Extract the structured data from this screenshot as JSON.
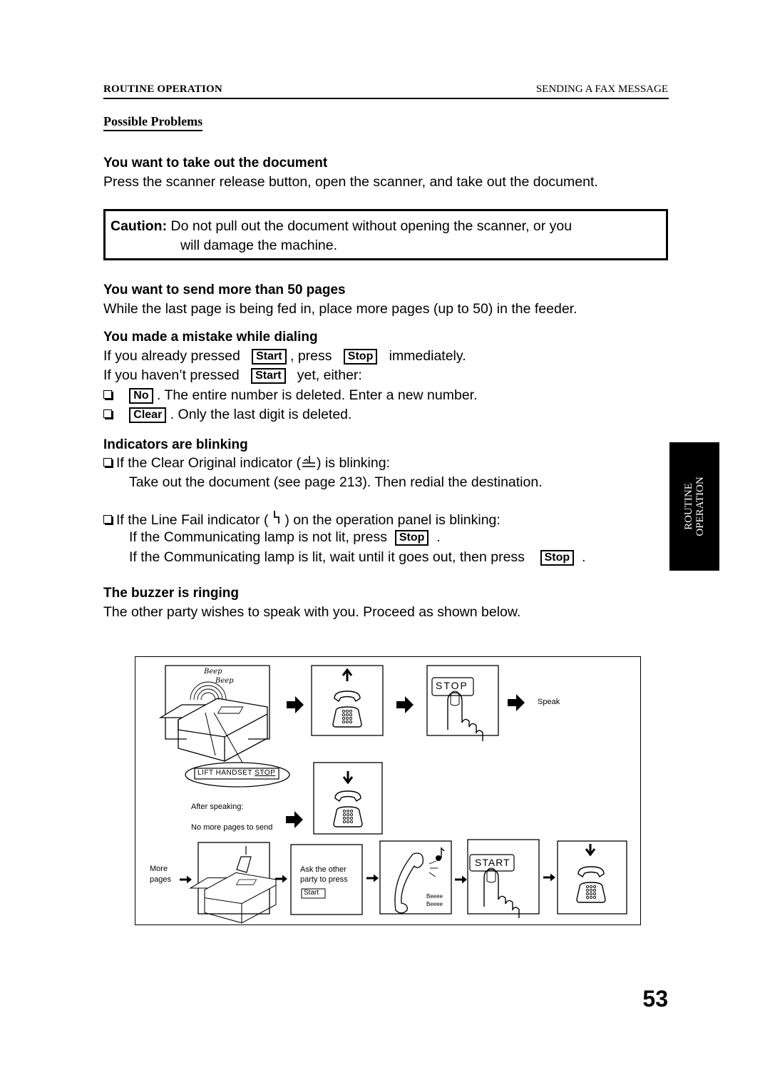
{
  "header": {
    "section": "ROUTINE OPERATION",
    "chapter": "SENDING A FAX MESSAGE"
  },
  "section_title": "Possible Problems",
  "problems": {
    "take_out": {
      "heading": "You want to take out the document",
      "text": "Press the scanner release button, open the scanner, and take out the document."
    },
    "caution": {
      "label": "Caution:",
      "line1": "Do not pull out the document without opening the scanner, or you",
      "line2": "will damage the machine."
    },
    "more_pages": {
      "heading": "You want to send more than 50 pages",
      "text": "While the last page is being fed in, place more pages (up to 50) in the feeder."
    },
    "mistake": {
      "heading": "You made a mistake while dialing",
      "line1_a": "If you already pressed",
      "line1_key1": "Start",
      "line1_b": ", press",
      "line1_key2": "Stop",
      "line1_c": "immediately.",
      "line2_a": "If you haven’t pressed",
      "line2_key": "Start",
      "line2_b": "yet, either:",
      "opt1_key": "No",
      "opt1_text": ". The entire number is deleted. Enter a new number.",
      "opt2_key": "Clear",
      "opt2_text": ". Only the last digit is deleted."
    },
    "indicators": {
      "heading": "Indicators are blinking",
      "item1_a": "If the Clear Original indicator (",
      "item1_b": ") is blinking:",
      "item1_detail": "Take out the document (see page 213). Then redial the destination.",
      "item2_a": "If the Line Fail indicator (",
      "item2_symbol": "ꜗ",
      "item2_b": ") on the operation panel is blinking:",
      "item2_line2_a": "If the Communicating lamp is not lit, press",
      "item2_line2_key": "Stop",
      "item2_line2_b": ".",
      "item2_line3_a": "If the Communicating lamp is lit, wait until it goes out, then press",
      "item2_line3_key": "Stop",
      "item2_line3_b": "."
    },
    "buzzer": {
      "heading": "The buzzer is ringing",
      "text": "The other party wishes to speak with you. Proceed as shown below."
    }
  },
  "figure": {
    "beep1": "Beep",
    "beep2": "Beep",
    "panel_label": "LIFT HANDSET",
    "panel_stop": "STOP",
    "stop_key": "STOP",
    "speak": "Speak",
    "after_speaking": "After speaking:",
    "no_more_pages": "No more pages to send",
    "more_pages_1": "More",
    "more_pages_2": "pages",
    "ask_line1": "Ask the other",
    "ask_line2": "party to press",
    "ask_key": "Start",
    "beeee1": "Beeee",
    "beeee2": "Beeee",
    "start_key": "START"
  },
  "side_tab": {
    "line1": "ROUTINE",
    "line2": "OPERATION"
  },
  "page_number": "53"
}
